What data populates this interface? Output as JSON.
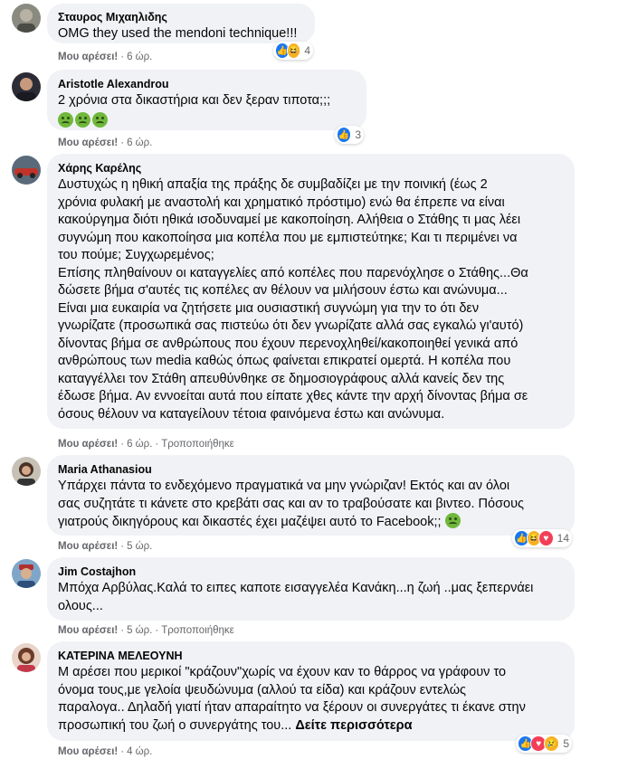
{
  "labels": {
    "like": "Μου αρέσει!",
    "edited": "Τροποποιήθηκε"
  },
  "comments": [
    {
      "author": "Σταυρος Μιχαηλιδης",
      "lines": [
        "OMG they used the mendoni technique!!!"
      ],
      "time": "6 ώρ.",
      "reaction_count": "4",
      "reaction_icons": [
        "like-icon",
        "haha-icon"
      ]
    },
    {
      "author": "Aristotle Alexandrou",
      "lines": [
        "2 χρόνια στα δικαστήρια και δεν ξεραν τιποτα;;;"
      ],
      "emoji_line": "nauseated-face-emoji x3",
      "time": "6 ώρ.",
      "reaction_count": "3",
      "reaction_icons": [
        "like-icon"
      ]
    },
    {
      "author": "Χάρης Καρέλης",
      "lines": [
        "Δυστυχώς η ηθική απαξία της πράξης δε συμβαδίζει με την ποινική (έως 2",
        "χρόνια φυλακή με αναστολή και χρηματικό πρόστιμο) ενώ θα έπρεπε να είναι",
        "κακούργημα διότι ηθικά ισοδυναμεί με κακοποίηση. Αλήθεια ο Στάθης τι μας λέει",
        "συγνώμη που κακοποίησα μια κοπέλα που με εμπιστεύτηκε; Και τι περιμένει να",
        "του πούμε; Συγχωρεμένος;",
        "Επίσης πληθαίνουν οι καταγγελίες από κοπέλες που παρενόχλησε ο Στάθης...Θα",
        "δώσετε βήμα σ'αυτές τις κοπέλες αν θέλουν να μιλήσουν έστω και ανώνυμα...",
        "Είναι μια ευκαιρία να ζητήσετε μια ουσιαστική συγνώμη για την το ότι δεν",
        "γνωρίζατε (προσωπικά σας πιστεύω ότι δεν γνωρίζατε αλλά σας εγκαλώ γι'αυτό)",
        "δίνοντας βήμα σε ανθρώπους που έχουν περενοχληθεί/κακοποιηθεί γενικά από",
        "ανθρώπους των media καθώς όπως φαίνεται επικρατεί ομερτά. Η κοπέλα που",
        "καταγγέλλει τον Στάθη απευθύνθηκε σε δημοσιογράφους αλλά κανείς δεν της",
        "έδωσε βήμα. Αν εννοείται αυτά που είπατε χθες κάντε την αρχή δίνοντας βήμα σε",
        "όσους θέλουν να καταγείλουν τέτοια φαινόμενα έστω και ανώνυμα."
      ],
      "time": "6 ώρ."
    },
    {
      "author": "Maria Athanasiou",
      "lines": [
        "Υπάρχει πάντα το ενδεχόμενο πραγματικά να μην γνώριζαν! Εκτός και αν όλοι",
        "σας συζητάτε τι κάνετε στο κρεβάτι σας και αν το τραβούσατε και βιντεο. Πόσους",
        "γιατρούς δικηγόρους και δικαστές έχει μαζέψει αυτό το Facebook;;"
      ],
      "time": "5 ώρ.",
      "reaction_count": "14",
      "reaction_icons": [
        "like-icon",
        "haha-icon",
        "love-icon"
      ]
    },
    {
      "author": "Jim Costajhon",
      "lines": [
        "Μπόχα Αρβύλας.Καλά το ειπες καποτε εισαγγελέα Κανάκη...η ζωή ..μας ξεπερνάει",
        "ολους..."
      ],
      "time": "5 ώρ."
    },
    {
      "author": "ΚΑΤΕΡΙΝΑ ΜΕΛΕΟΥΝΗ",
      "lines": [
        "Μ αρέσει που μερικοί \"κράζουν\"χωρίς να έχουν καν το θάρρος να γράφουν το",
        "όνομα τους,με γελοία ψευδώνυμα (αλλού τα είδα) και κράζουν εντελώς",
        "παραλογα.. Δηλαδή γιατί ήταν απαραίτητο να ξέρουν οι συνεργάτες τι έκανε στην",
        "προσωπική του ζωή ο συνεργάτης του..."
      ],
      "see_more": "Δείτε περισσότερα",
      "time": "4 ώρ.",
      "reaction_count": "5",
      "reaction_icons": [
        "like-icon",
        "love-icon",
        "sad-icon"
      ]
    }
  ]
}
